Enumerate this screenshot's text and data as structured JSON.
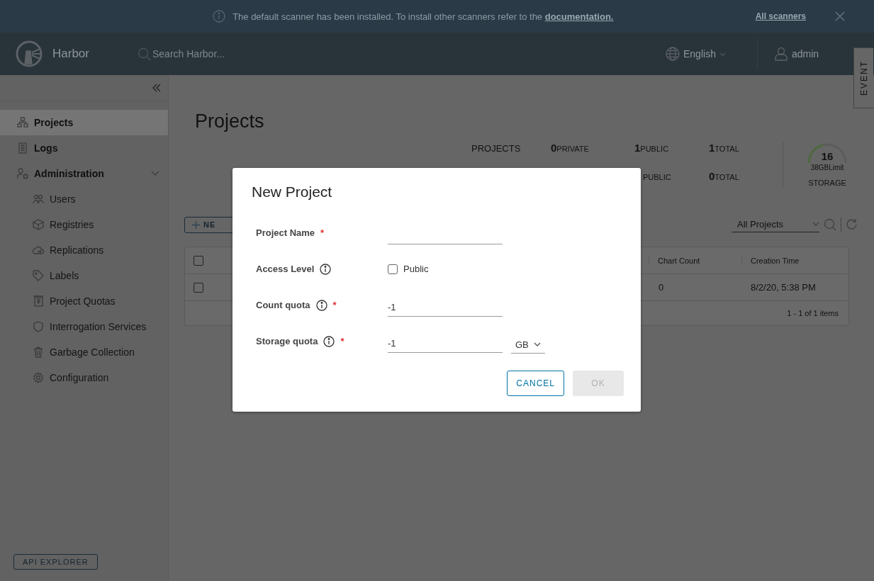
{
  "banner": {
    "message": "The default scanner has been installed. To install other scanners refer to the",
    "link": "documentation.",
    "action": "All scanners"
  },
  "header": {
    "app_name": "Harbor",
    "search": {
      "placeholder": "Search Harbor..."
    },
    "language": "English",
    "user": "admin"
  },
  "event_tab": "EVENT",
  "sidebar": {
    "items": [
      {
        "label": "Projects",
        "selected": true
      },
      {
        "label": "Logs",
        "selected": false
      },
      {
        "label": "Administration",
        "selected": false,
        "expanded": true,
        "children": [
          {
            "label": "Users",
            "selected": false
          },
          {
            "label": "Registries",
            "selected": false
          },
          {
            "label": "Replications",
            "selected": false
          },
          {
            "label": "Labels",
            "selected": false
          },
          {
            "label": "Project Quotas",
            "selected": false
          },
          {
            "label": "Interrogation Services",
            "selected": false
          },
          {
            "label": "Garbage Collection",
            "selected": false
          },
          {
            "label": "Configuration",
            "selected": false
          }
        ]
      }
    ],
    "api_button": "API EXPLORER"
  },
  "main": {
    "title": "Projects",
    "stats": {
      "label": "PROJECTS",
      "rows": [
        [
          {
            "value": "0",
            "label": "PRIVATE"
          },
          {
            "value": "1",
            "label": "PUBLIC"
          },
          {
            "value": "1",
            "label": "TOTAL"
          }
        ],
        [
          "",
          {
            "label": "PUBLIC"
          },
          {
            "value": "0",
            "label": "TOTAL"
          }
        ]
      ],
      "storage": {
        "value": "16",
        "limit": "38GBLimit",
        "label": "STORAGE"
      }
    },
    "new_button": "NE",
    "filter": "All Projects",
    "table": {
      "columns": [
        "Chart Count",
        "Creation Time"
      ],
      "header_checked": false,
      "rows": [
        {
          "checked": false,
          "cells": [
            "0",
            "8/2/20, 5:38 PM"
          ]
        }
      ],
      "footer": "1 - 1 of 1 items"
    }
  },
  "dialog": {
    "title": "New Project",
    "fields": [
      {
        "kind": "text",
        "label": "Project Name",
        "info": false,
        "required_mark": "*"
      },
      {
        "kind": "checkbox",
        "label": "Access Level",
        "info": true,
        "option": "Public",
        "checked": false
      },
      {
        "kind": "text",
        "label": "Count quota",
        "info": true,
        "required_mark": "*",
        "value": "-1"
      },
      {
        "kind": "text",
        "label": "Storage quota",
        "info": true,
        "required_mark": "*",
        "value": "-1",
        "unit": "GB"
      }
    ],
    "buttons": [
      {
        "label": "CANCEL",
        "disabled": false
      },
      {
        "label": "OK",
        "disabled": true
      }
    ]
  }
}
